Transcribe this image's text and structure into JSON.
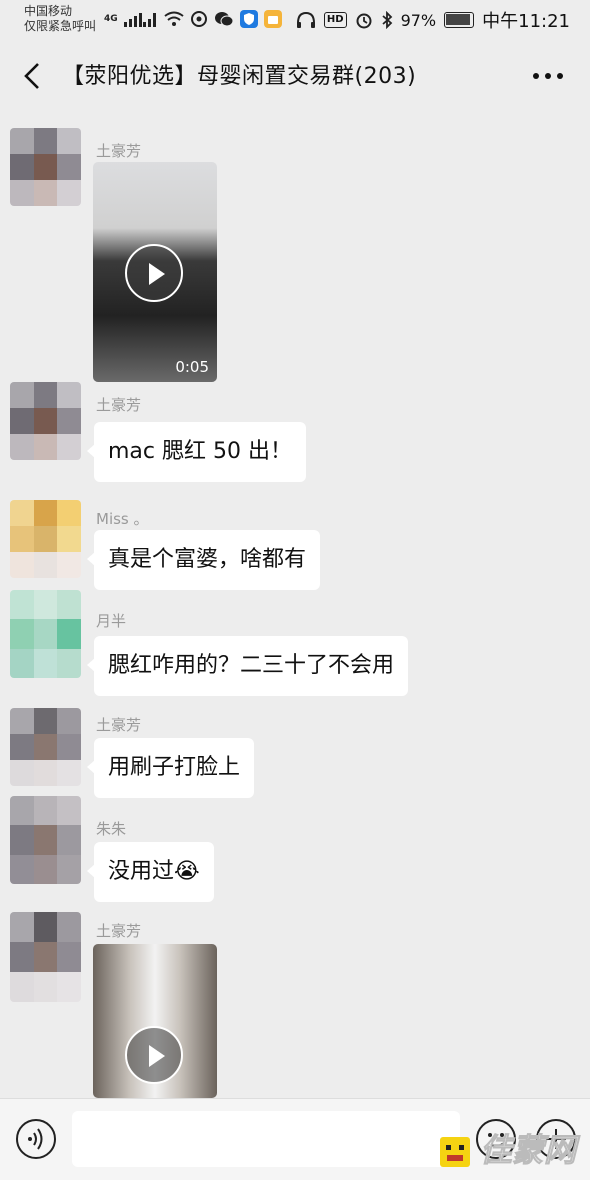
{
  "status_bar": {
    "carrier_line1": "中国移动",
    "carrier_line2": "仅限紧急呼叫",
    "network": "4G",
    "hd_badge": "HD",
    "battery": "97%",
    "time": "中午11:21",
    "icons": [
      "signal-icon",
      "wifi-icon",
      "weibo-icon",
      "wechat-icon",
      "shield-app-icon",
      "bag-app-icon",
      "headphones-icon",
      "alarm-icon",
      "bluetooth-icon",
      "battery-icon"
    ]
  },
  "chat": {
    "title": "【荥阳优选】母婴闲置交易群(203)",
    "back_icon": "back-arrow-icon",
    "more_icon": "more-dots-icon"
  },
  "messages": [
    {
      "sender": "土豪芳",
      "type": "video",
      "duration": "0:05",
      "thumb_colors": [
        "#d9dadb",
        "#4a4a4a",
        "#1e1e1e"
      ]
    },
    {
      "sender": "土豪芳",
      "type": "text",
      "text": "mac 腮红 50 出！"
    },
    {
      "sender": "Miss 。",
      "type": "text",
      "text": "真是个富婆，啥都有"
    },
    {
      "sender": "月半",
      "type": "text",
      "text": "腮红咋用的？二三十了不会用"
    },
    {
      "sender": "土豪芳",
      "type": "text",
      "text": "用刷子打脸上"
    },
    {
      "sender": "朱朱",
      "type": "text",
      "text": "没用过😭"
    },
    {
      "sender": "土豪芳",
      "type": "video",
      "thumb_colors": [
        "#c7c2bb",
        "#eeeeee",
        "#5b5550"
      ]
    }
  ],
  "input_bar": {
    "placeholder": "",
    "voice_icon": "voice-icon",
    "emoji_icon": "emoji-icon",
    "plus_icon": "plus-icon",
    "watermark": "佳蒙网"
  },
  "colors": {
    "background": "#ededed",
    "bubble": "#ffffff",
    "sender_name": "#9a9a9a"
  }
}
